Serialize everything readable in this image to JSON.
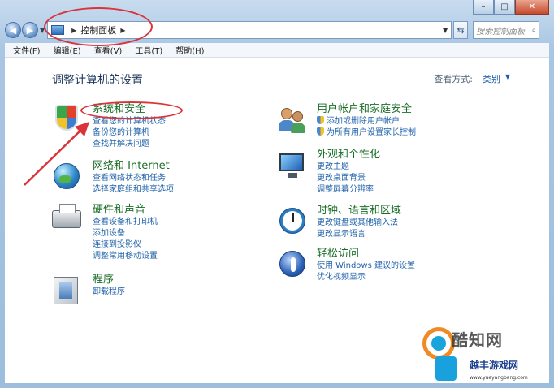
{
  "window": {
    "caption_buttons": [
      "–",
      "□",
      "✕"
    ]
  },
  "navigation": {
    "breadcrumb": "控制面板",
    "search_placeholder": "搜索控制面板"
  },
  "menu": [
    "文件(F)",
    "编辑(E)",
    "查看(V)",
    "工具(T)",
    "帮助(H)"
  ],
  "page": {
    "title": "调整计算机的设置",
    "view_by_label": "查看方式:",
    "view_by_value": "类别"
  },
  "categories": [
    {
      "title": "系统和安全",
      "icon": "security-shield-icon",
      "links": [
        "查看您的计算机状态",
        "备份您的计算机",
        "查找并解决问题"
      ]
    },
    {
      "title": "网络和 Internet",
      "icon": "network-globe-icon",
      "links": [
        "查看网络状态和任务",
        "选择家庭组和共享选项"
      ]
    },
    {
      "title": "硬件和声音",
      "icon": "printer-icon",
      "links": [
        "查看设备和打印机",
        "添加设备",
        "连接到投影仪",
        "调整常用移动设置"
      ]
    },
    {
      "title": "程序",
      "icon": "programs-box-icon",
      "links": [
        "卸载程序"
      ]
    },
    {
      "title": "用户帐户和家庭安全",
      "icon": "users-icon",
      "links": [
        "添加或删除用户帐户",
        "为所有用户设置家长控制"
      ]
    },
    {
      "title": "外观和个性化",
      "icon": "monitor-icon",
      "links": [
        "更改主题",
        "更改桌面背景",
        "调整屏幕分辨率"
      ]
    },
    {
      "title": "时钟、语言和区域",
      "icon": "clock-globe-icon",
      "links": [
        "更改键盘或其他输入法",
        "更改显示语言"
      ]
    },
    {
      "title": "轻松访问",
      "icon": "accessibility-icon",
      "links": [
        "使用 Windows 建议的设置",
        "优化视频显示"
      ]
    }
  ],
  "watermark": {
    "brand1": "酷知网",
    "brand2": "越丰游戏网",
    "url": "www.yueyangbang.com"
  },
  "annotation_color": "#d9343a"
}
